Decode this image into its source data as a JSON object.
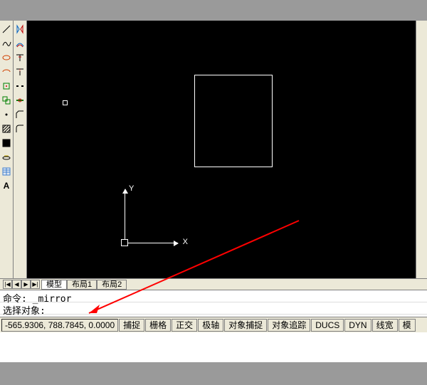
{
  "ucs": {
    "x_label": "X",
    "y_label": "Y"
  },
  "tabs": {
    "model": "模型",
    "layout1": "布局1",
    "layout2": "布局2"
  },
  "nav": {
    "first": "|◀",
    "prev": "◀",
    "next": "▶",
    "last": "▶|"
  },
  "cmd": {
    "line1": "命令: _mirror",
    "line2": "选择对象:"
  },
  "status": {
    "coords": "-565.9306, 788.7845, 0.0000",
    "snap": "捕捉",
    "grid": "栅格",
    "ortho": "正交",
    "polar": "极轴",
    "osnap": "对象捕捉",
    "otrack": "对象追踪",
    "ducs": "DUCS",
    "dyn": "DYN",
    "lwt": "线宽",
    "model": "模"
  }
}
